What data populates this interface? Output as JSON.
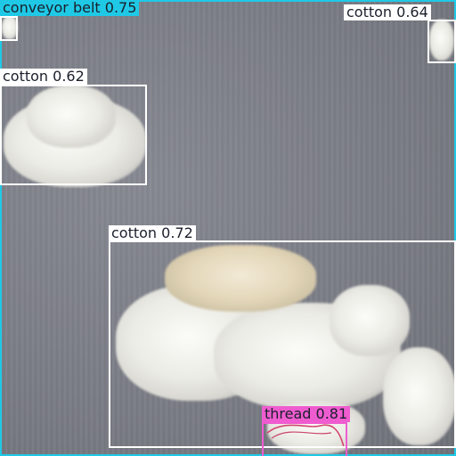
{
  "detections": [
    {
      "label": "conveyor belt",
      "score": "0.75",
      "text": "conveyor belt 0.75",
      "color": "#1fc9e6"
    },
    {
      "label": "cotton",
      "score": "0.64",
      "text": "cotton 0.64",
      "color": "#ffffff"
    },
    {
      "label": "cotton",
      "score": "0.62",
      "text": "cotton 0.62",
      "color": "#ffffff"
    },
    {
      "label": "cotton",
      "score": "0.72",
      "text": "cotton 0.72",
      "color": "#ffffff"
    },
    {
      "label": "thread",
      "score": "0.81",
      "text": "thread 0.81",
      "color": "#ef5cd0"
    }
  ]
}
